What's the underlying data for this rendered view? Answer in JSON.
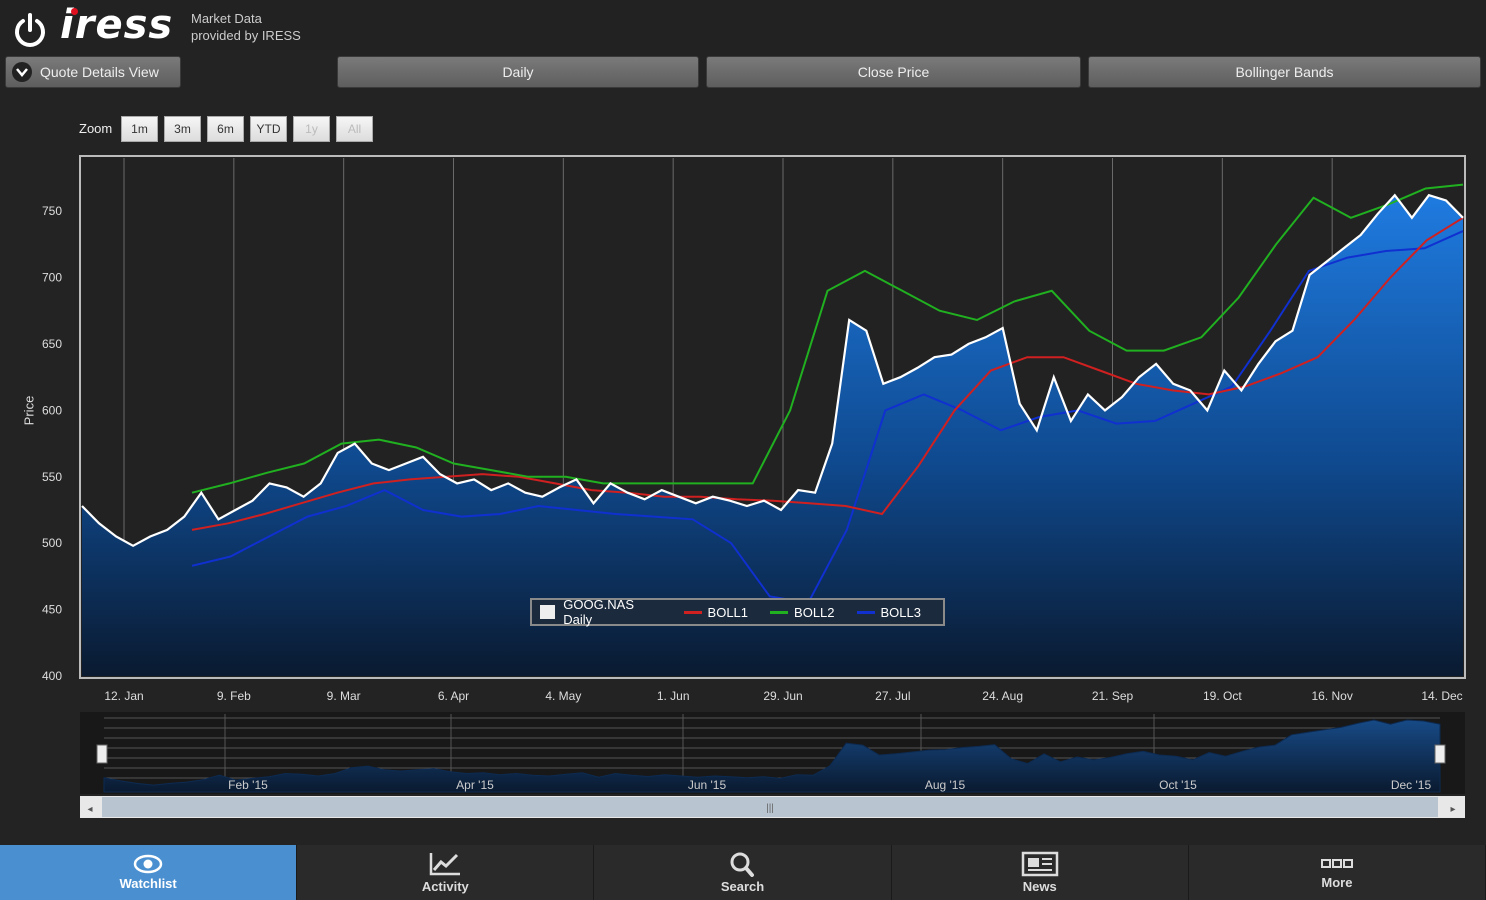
{
  "header": {
    "brand": "iress",
    "provider_line1": "Market Data",
    "provider_line2": "provided by IRESS"
  },
  "toolbar": {
    "quote_details": "Quote Details View",
    "period": "Daily",
    "price_type": "Close Price",
    "indicator": "Bollinger Bands"
  },
  "zoom": {
    "label": "Zoom",
    "buttons": [
      "1m",
      "3m",
      "6m",
      "YTD",
      "1y",
      "All"
    ]
  },
  "chart_data": {
    "type": "area",
    "ylabel": "Price",
    "ylim": [
      400,
      790
    ],
    "yticks": [
      400,
      450,
      500,
      550,
      600,
      650,
      700,
      750
    ],
    "xticks": [
      "12. Jan",
      "9. Feb",
      "9. Mar",
      "6. Apr",
      "4. May",
      "1. Jun",
      "29. Jun",
      "27. Jul",
      "24. Aug",
      "21. Sep",
      "19. Oct",
      "16. Nov",
      "14. Dec"
    ],
    "grid": true,
    "legend_position": "bottom-center",
    "series": [
      {
        "name": "GOOG.NAS Daily",
        "color": "#ffffff",
        "values": [
          528,
          515,
          505,
          498,
          505,
          510,
          520,
          538,
          518,
          525,
          532,
          545,
          542,
          535,
          545,
          568,
          575,
          560,
          555,
          560,
          565,
          552,
          545,
          548,
          540,
          545,
          538,
          535,
          542,
          548,
          530,
          545,
          538,
          533,
          540,
          535,
          530,
          535,
          532,
          528,
          532,
          525,
          540,
          538,
          575,
          668,
          660,
          620,
          625,
          632,
          640,
          642,
          650,
          655,
          662,
          605,
          585,
          625,
          592,
          612,
          600,
          610,
          625,
          635,
          620,
          615,
          600,
          630,
          615,
          635,
          652,
          660,
          702,
          712,
          722,
          732,
          748,
          762,
          745,
          762,
          758,
          745
        ]
      },
      {
        "name": "BOLL1",
        "color": "#d02020",
        "values": [
          510,
          515,
          522,
          530,
          538,
          545,
          548,
          550,
          552,
          550,
          545,
          540,
          538,
          535,
          535,
          533,
          532,
          530,
          528,
          522,
          558,
          600,
          630,
          640,
          640,
          630,
          620,
          615,
          612,
          618,
          628,
          640,
          668,
          700,
          728,
          745
        ]
      },
      {
        "name": "BOLL2",
        "color": "#20b020",
        "values": [
          538,
          545,
          553,
          560,
          575,
          578,
          572,
          560,
          555,
          550,
          550,
          545,
          545,
          545,
          545,
          545,
          600,
          690,
          705,
          690,
          675,
          668,
          682,
          690,
          660,
          645,
          645,
          655,
          685,
          725,
          760,
          745,
          755,
          767,
          770
        ]
      },
      {
        "name": "BOLL3",
        "color": "#1030d0",
        "values": [
          483,
          490,
          505,
          520,
          528,
          540,
          525,
          520,
          522,
          528,
          525,
          522,
          520,
          518,
          500,
          460,
          455,
          510,
          600,
          612,
          600,
          585,
          595,
          600,
          590,
          592,
          605,
          618,
          660,
          705,
          715,
          720,
          722,
          735
        ]
      }
    ]
  },
  "navigator": {
    "labels": [
      "Feb '15",
      "Apr '15",
      "Jun '15",
      "Aug '15",
      "Oct '15",
      "Dec '15"
    ]
  },
  "bottom_nav": [
    {
      "label": "Watchlist",
      "icon": "eye-icon",
      "active": true
    },
    {
      "label": "Activity",
      "icon": "chart-icon",
      "active": false
    },
    {
      "label": "Search",
      "icon": "search-icon",
      "active": false
    },
    {
      "label": "News",
      "icon": "news-icon",
      "active": false
    },
    {
      "label": "More",
      "icon": "more-icon",
      "active": false
    }
  ],
  "colors": {
    "accent": "#4a90d0",
    "area_top": "#1f7be0",
    "area_bottom": "#0a1a30"
  }
}
